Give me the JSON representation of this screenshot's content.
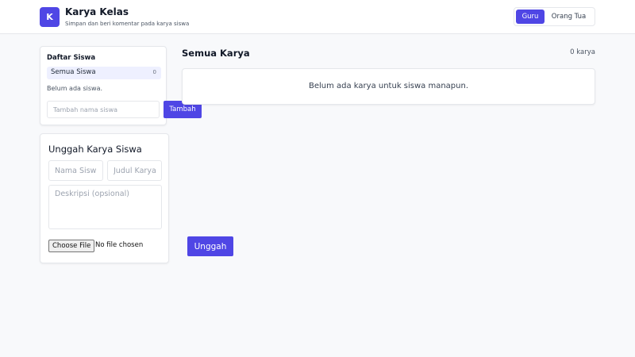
{
  "colors": {
    "accent": "#4f46e5",
    "background": "#f8f9fb",
    "border": "#e5e7eb",
    "selected_row": "#eef0ff"
  },
  "header": {
    "logo_letter": "K",
    "title": "Karya Kelas",
    "subtitle": "Simpan dan beri komentar pada karya siswa",
    "roles": [
      {
        "label": "Guru",
        "active": true
      },
      {
        "label": "Orang Tua",
        "active": false
      }
    ]
  },
  "students": {
    "title": "Daftar Siswa",
    "all_label": "Semua Siswa",
    "all_count": "0",
    "empty_text": "Belum ada siswa.",
    "input_placeholder": "Tambah nama siswa",
    "add_button": "Tambah"
  },
  "upload": {
    "title": "Unggah Karya Siswa",
    "student_placeholder": "Nama Siswa",
    "title_placeholder": "Judul Karya",
    "description_placeholder": "Deskripsi (opsional)",
    "file_button": "Choose File",
    "file_status": "No file chosen",
    "submit_button": "Unggah"
  },
  "works": {
    "title": "Semua Karya",
    "count": "0 karya",
    "empty_text": "Belum ada karya untuk siswa manapun."
  }
}
